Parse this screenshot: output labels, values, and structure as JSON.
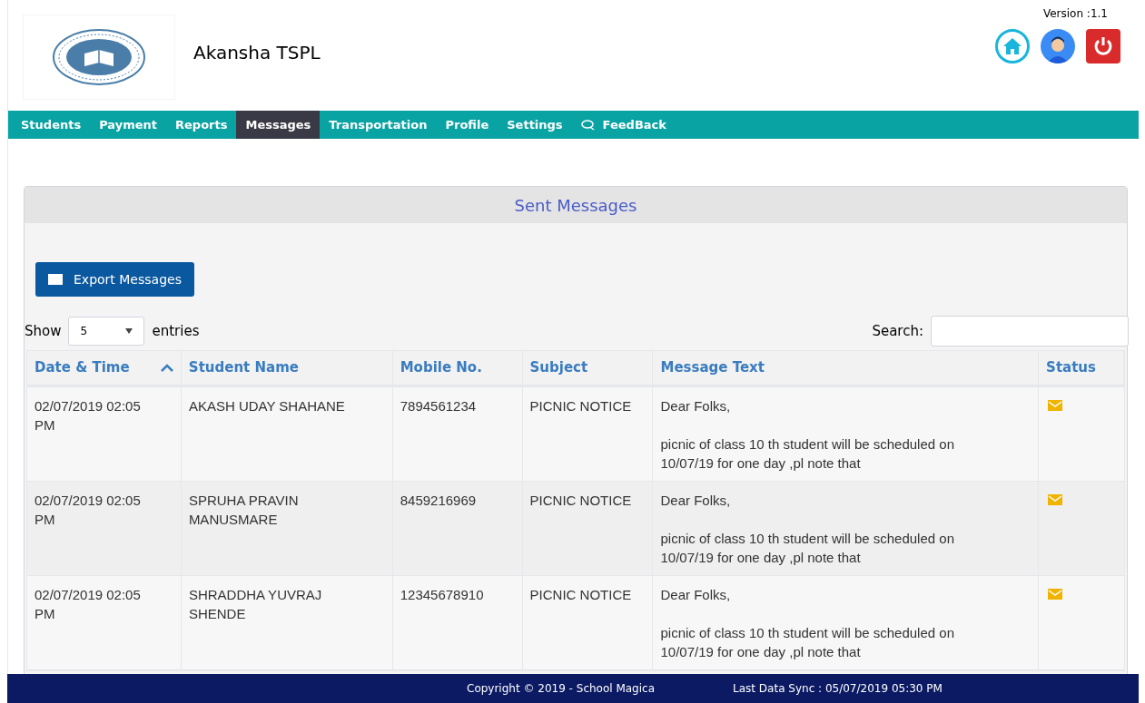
{
  "header": {
    "school_name": "Akansha TSPL",
    "version": "Version :1.1"
  },
  "nav": [
    {
      "label": "Students",
      "selected": false
    },
    {
      "label": "Payment",
      "selected": false
    },
    {
      "label": "Reports",
      "selected": false
    },
    {
      "label": "Messages",
      "selected": true
    },
    {
      "label": "Transportation",
      "selected": false
    },
    {
      "label": "Profile",
      "selected": false
    },
    {
      "label": "Settings",
      "selected": false
    },
    {
      "label": "FeedBack",
      "selected": false,
      "kind": "chat"
    }
  ],
  "panel": {
    "title": "Sent Messages",
    "export_button": "Export Messages",
    "show_label": "Show",
    "page_size": "5",
    "entries_label": "entries",
    "search_label": "Search:"
  },
  "table": {
    "columns": [
      {
        "label": "Date & Time",
        "sorted": true
      },
      {
        "label": "Student Name",
        "sorted": false
      },
      {
        "label": "Mobile No.",
        "sorted": false
      },
      {
        "label": "Subject",
        "sorted": false
      },
      {
        "label": "Message Text",
        "sorted": false
      },
      {
        "label": "Status",
        "sorted": false
      }
    ],
    "rows": [
      {
        "date": "02/07/2019 02:05 PM",
        "student": "AKASH UDAY SHAHANE",
        "mobile": "7894561234",
        "subject": "PICNIC NOTICE",
        "message": [
          "Dear Folks,",
          "picnic of class 10 th student will be scheduled on 10/07/19 for one day ,pl note that"
        ],
        "kind": "sent"
      },
      {
        "date": "02/07/2019 02:05 PM",
        "student": "SPRUHA PRAVIN MANUSMARE",
        "mobile": "8459216969",
        "subject": "PICNIC NOTICE",
        "message": [
          "Dear Folks,",
          "picnic of class 10 th student will be scheduled on 10/07/19 for one day ,pl note that"
        ],
        "kind": "sent"
      },
      {
        "date": "02/07/2019 02:05 PM",
        "student": "SHRADDHA YUVRAJ SHENDE",
        "mobile": "12345678910",
        "subject": "PICNIC NOTICE",
        "message": [
          "Dear Folks,",
          "picnic of class 10 th student will be scheduled on 10/07/19 for one day ,pl note that"
        ],
        "kind": "sent"
      }
    ]
  },
  "footer": {
    "copyright": "Copyright © 2019 - School Magica",
    "last_sync": "Last Data Sync : 05/07/2019 05:30 PM"
  }
}
